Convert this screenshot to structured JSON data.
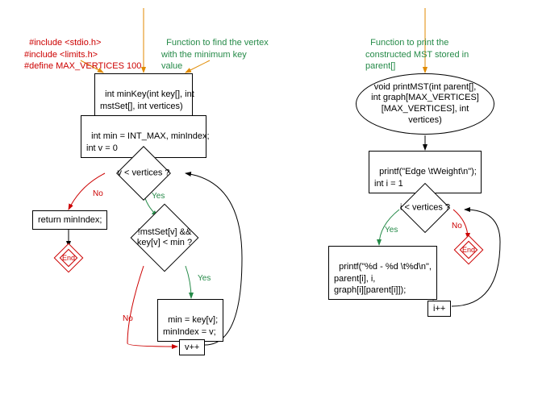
{
  "left": {
    "includes": "#include <stdio.h>\n#include <limits.h>\n#define MAX_VERTICES 100",
    "comment": "Function to find the vertex\nwith the minimum key\nvalue",
    "func_sig": "int minKey(int key[], int\nmstSet[], int vertices)",
    "init": "int min = INT_MAX, minIndex;\nint v = 0",
    "cond1": "v < vertices ?",
    "return": "return minIndex;",
    "cond2": "!mstSet[v] &&\nkey[v] < min ?",
    "assign": "min = key[v];\nminIndex = v;",
    "incr": "v++",
    "end": "End",
    "yes": "Yes",
    "no": "No"
  },
  "right": {
    "comment": "Function to print the\nconstructed MST stored in\nparent[]",
    "func_sig": "void printMST(int parent[],\nint graph[MAX_VERTICES]\n[MAX_VERTICES], int\nvertices)",
    "init": "printf(\"Edge \\tWeight\\n\");\nint i = 1",
    "cond": "i < vertices ?",
    "print": "printf(\"%d - %d \\t%d\\n\",\nparent[i], i,\ngraph[i][parent[i]]);",
    "incr": "i++",
    "end": "End",
    "yes": "Yes",
    "no": "No"
  }
}
